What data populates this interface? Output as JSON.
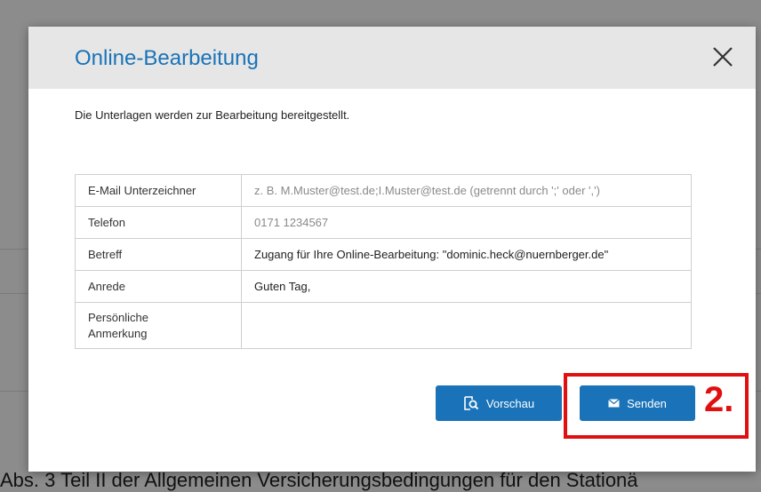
{
  "dialog": {
    "title": "Online-Bearbeitung",
    "intro": "Die Unterlagen werden zur Bearbeitung bereitgestellt.",
    "fields": [
      {
        "label": "E-Mail Unterzeichner",
        "value": "z. B. M.Muster@test.de;I.Muster@test.de (getrennt durch ';' oder ',')"
      },
      {
        "label": "Telefon",
        "value": "0171 1234567"
      },
      {
        "label": "Betreff",
        "value": "Zugang für Ihre Online-Bearbeitung: \"dominic.heck@nuernberger.de\""
      },
      {
        "label": "Anrede",
        "value": "Guten Tag,"
      },
      {
        "label_line1": "Persönliche",
        "label_line2": "Anmerkung",
        "value": ""
      }
    ],
    "buttons": {
      "preview": "Vorschau",
      "send": "Senden"
    }
  },
  "annotation": {
    "step": "2."
  },
  "background": {
    "footer_text": "Abs. 3 Teil II der Allgemeinen Versicherungsbedingungen für den Stationä"
  },
  "colors": {
    "accent": "#1a73b8",
    "highlight": "#e01010",
    "header_bg": "#e6e6e6"
  },
  "icons": [
    "close-icon",
    "preview-icon",
    "envelope-icon"
  ]
}
